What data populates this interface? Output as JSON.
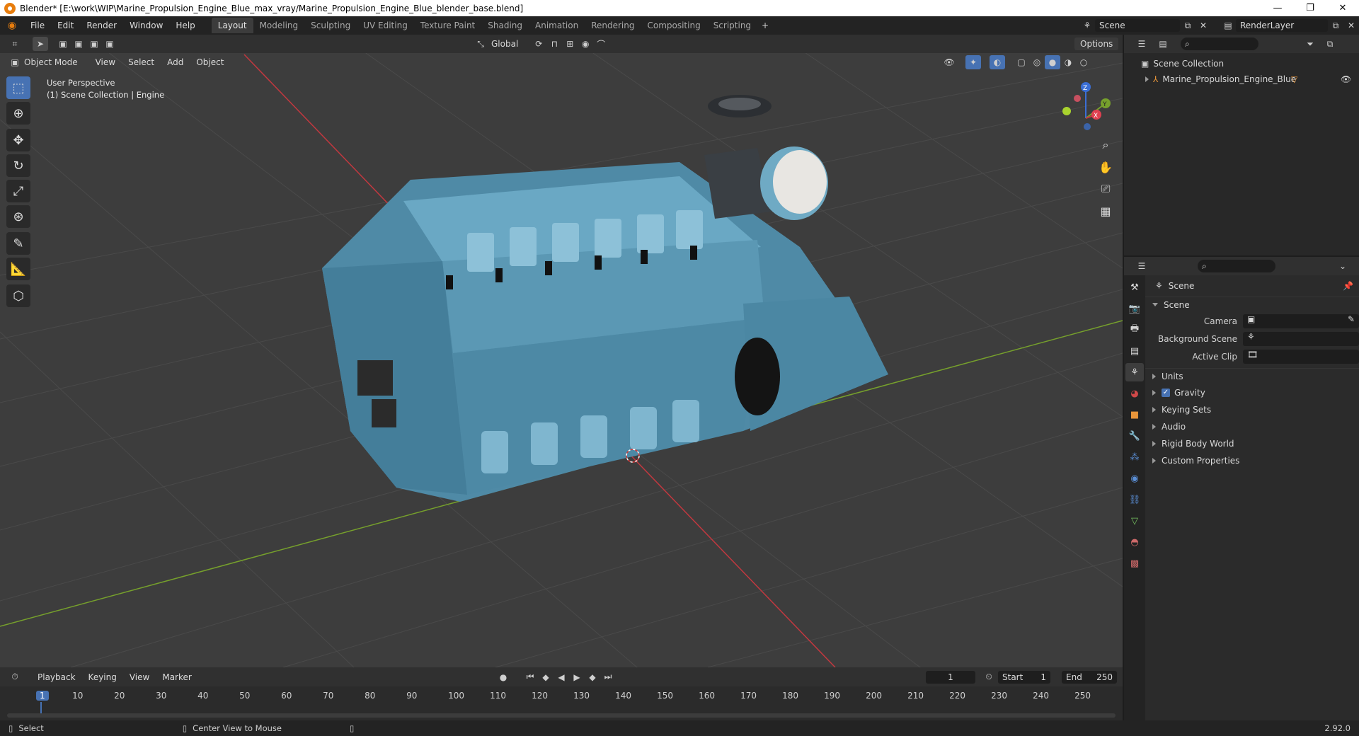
{
  "window": {
    "title": "Blender* [E:\\work\\WIP\\Marine_Propulsion_Engine_Blue_max_vray/Marine_Propulsion_Engine_Blue_blender_base.blend]",
    "controls": [
      "minimize-icon",
      "restore-icon",
      "close-icon"
    ]
  },
  "menu": [
    "File",
    "Edit",
    "Render",
    "Window",
    "Help"
  ],
  "workspaces": [
    "Layout",
    "Modeling",
    "Sculpting",
    "UV Editing",
    "Texture Paint",
    "Shading",
    "Animation",
    "Rendering",
    "Compositing",
    "Scripting"
  ],
  "active_workspace": "Layout",
  "scene_selector": {
    "value": "Scene"
  },
  "view_layer_selector": {
    "value": "RenderLayer"
  },
  "tool_header": {
    "orientation": "Global",
    "options_label": "Options"
  },
  "viewport_header": {
    "mode": "Object Mode",
    "menus": [
      "View",
      "Select",
      "Add",
      "Object"
    ]
  },
  "viewport": {
    "perspective_label": "User Perspective",
    "collection_label": "(1) Scene Collection | Engine",
    "gizmo_axes": {
      "x": "X",
      "y": "Y",
      "z": "Z"
    },
    "colors": {
      "background": "#3d3d3d",
      "grid": "#4a4a4a",
      "x_axis": "#c2383f",
      "y_axis": "#76a02c",
      "engine": "#5b98b4"
    }
  },
  "outliner": {
    "root": "Scene Collection",
    "items": [
      {
        "name": "Marine_Propulsion_Engine_Blue"
      }
    ]
  },
  "properties": {
    "context": "Scene",
    "panel_title": "Scene",
    "fields": [
      {
        "label": "Camera"
      },
      {
        "label": "Background Scene"
      },
      {
        "label": "Active Clip"
      }
    ],
    "sections": [
      {
        "label": "Units",
        "checkbox": false
      },
      {
        "label": "Gravity",
        "checkbox": true
      },
      {
        "label": "Keying Sets",
        "checkbox": false
      },
      {
        "label": "Audio",
        "checkbox": false
      },
      {
        "label": "Rigid Body World",
        "checkbox": false
      },
      {
        "label": "Custom Properties",
        "checkbox": false
      }
    ]
  },
  "timeline": {
    "menus": [
      "Playback",
      "Keying",
      "View",
      "Marker"
    ],
    "current_frame": "1",
    "start_label": "Start",
    "start": "1",
    "end_label": "End",
    "end": "250",
    "ticks": [
      "1",
      "10",
      "20",
      "30",
      "40",
      "50",
      "60",
      "70",
      "80",
      "90",
      "100",
      "110",
      "120",
      "130",
      "140",
      "150",
      "160",
      "170",
      "180",
      "190",
      "200",
      "210",
      "220",
      "230",
      "240",
      "250"
    ]
  },
  "status": {
    "left": "Select",
    "middle": "Center View to Mouse",
    "version": "2.92.0"
  }
}
